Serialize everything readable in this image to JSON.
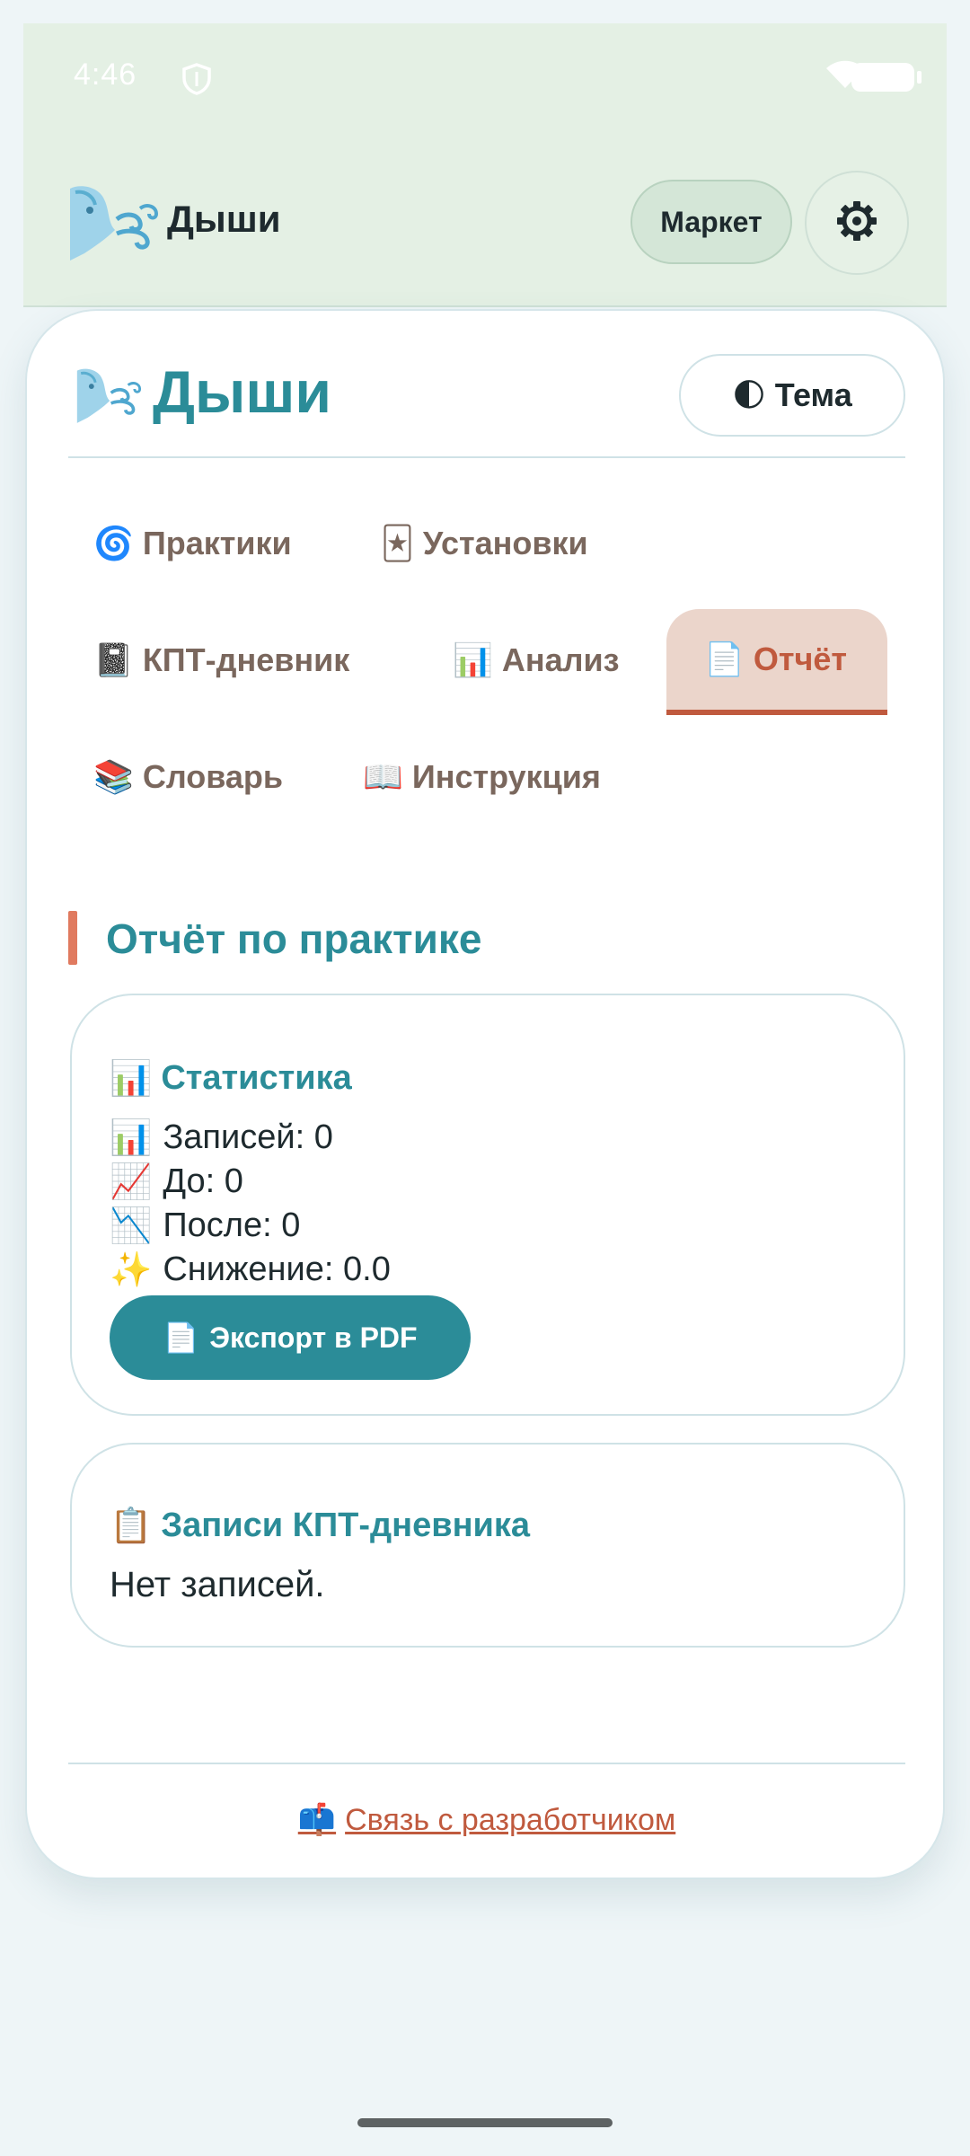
{
  "status_bar": {
    "time": "4:46"
  },
  "app_bar": {
    "title": "Дыши",
    "market_label": "Маркет",
    "settings_icon": "gear-icon",
    "logo_icon": "breath-face-icon",
    "background": "#e4f0e4"
  },
  "card": {
    "title": "Дыши",
    "theme_label": "Тема",
    "theme_emoji": "🌓"
  },
  "tabs": [
    {
      "emoji": "🌀",
      "label": "Практики",
      "active": false
    },
    {
      "emoji": "🃏",
      "label": "Установки",
      "active": false
    },
    {
      "emoji": "📓",
      "label": "КПТ-дневник",
      "active": false
    },
    {
      "emoji": "📊",
      "label": "Анализ",
      "active": false
    },
    {
      "emoji": "📄",
      "label": "Отчёт",
      "active": true
    },
    {
      "emoji": "📚",
      "label": "Словарь",
      "active": false
    },
    {
      "emoji": "📖",
      "label": "Инструкция",
      "active": false
    }
  ],
  "report": {
    "section_title": "Отчёт по практике",
    "stats": {
      "title_emoji": "📊",
      "title": "Статистика",
      "lines": [
        {
          "emoji": "📊",
          "text": "Записей: 0"
        },
        {
          "emoji": "📈",
          "text": "До: 0"
        },
        {
          "emoji": "📉",
          "text": "После: 0"
        },
        {
          "emoji": "✨",
          "text": "Снижение: 0.0"
        }
      ],
      "export_emoji": "📄",
      "export_label": "Экспорт в PDF"
    },
    "cbt": {
      "title_emoji": "📋",
      "title": "Записи КПТ-дневника",
      "empty_text": "Нет записей."
    }
  },
  "footer": {
    "contact_emoji": "📫",
    "contact_label": "Связь с разработчиком"
  },
  "colors": {
    "accent": "#2b8c98",
    "active_tab": "#c05a3e",
    "active_tab_bg": "#ebd5cb",
    "section_marker": "#e07a5f"
  }
}
